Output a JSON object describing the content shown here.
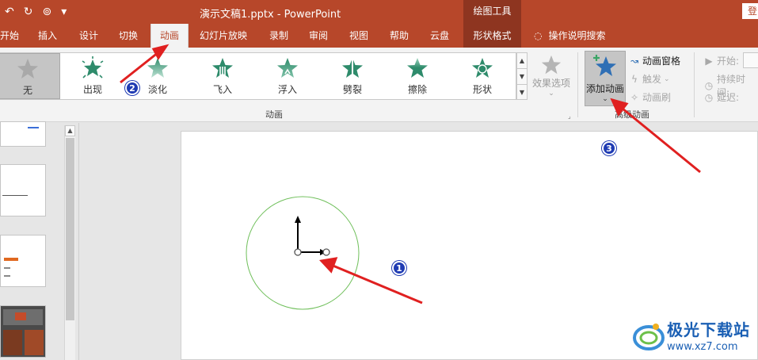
{
  "titlebar": {
    "document_title": "演示文稿1.pptx  -  PowerPoint",
    "context_group": "绘图工具",
    "login": "登"
  },
  "tabs": [
    {
      "label": "开始"
    },
    {
      "label": "插入"
    },
    {
      "label": "设计"
    },
    {
      "label": "切换"
    },
    {
      "label": "动画",
      "active": true
    },
    {
      "label": "幻灯片放映"
    },
    {
      "label": "录制"
    },
    {
      "label": "审阅"
    },
    {
      "label": "视图"
    },
    {
      "label": "帮助"
    },
    {
      "label": "云盘"
    },
    {
      "label": "形状格式",
      "context": true
    },
    {
      "label": "操作说明搜索"
    }
  ],
  "animation_gallery": {
    "items": [
      {
        "label": "无",
        "icon": "star-none-icon",
        "selected": true
      },
      {
        "label": "出现",
        "icon": "star-appear-icon"
      },
      {
        "label": "淡化",
        "icon": "star-fade-icon"
      },
      {
        "label": "飞入",
        "icon": "star-fly-in-icon"
      },
      {
        "label": "浮入",
        "icon": "star-float-in-icon"
      },
      {
        "label": "劈裂",
        "icon": "star-split-icon"
      },
      {
        "label": "擦除",
        "icon": "star-wipe-icon"
      },
      {
        "label": "形状",
        "icon": "star-shape-icon"
      }
    ],
    "effect_options": "效果选项",
    "group_label": "动画"
  },
  "advanced_animation": {
    "add_animation": "添加动画",
    "animation_pane": "动画窗格",
    "trigger": "触发",
    "animation_painter": "动画刷",
    "group_label": "高级动画"
  },
  "timing": {
    "start": "开始:",
    "duration": "持续时间:",
    "delay": "延迟:"
  },
  "annotations": {
    "badge1": "1",
    "badge2": "2",
    "badge3": "3",
    "arrow_color": "#e02020"
  },
  "watermark": {
    "title": "极光下载站",
    "url": "www.xz7.com"
  },
  "colors": {
    "accent": "#b7472a",
    "context_tab": "#8e3520",
    "star_green": "#2e8b6b",
    "add_star_blue": "#2f6fb5",
    "circle": "#6fbf5a"
  }
}
